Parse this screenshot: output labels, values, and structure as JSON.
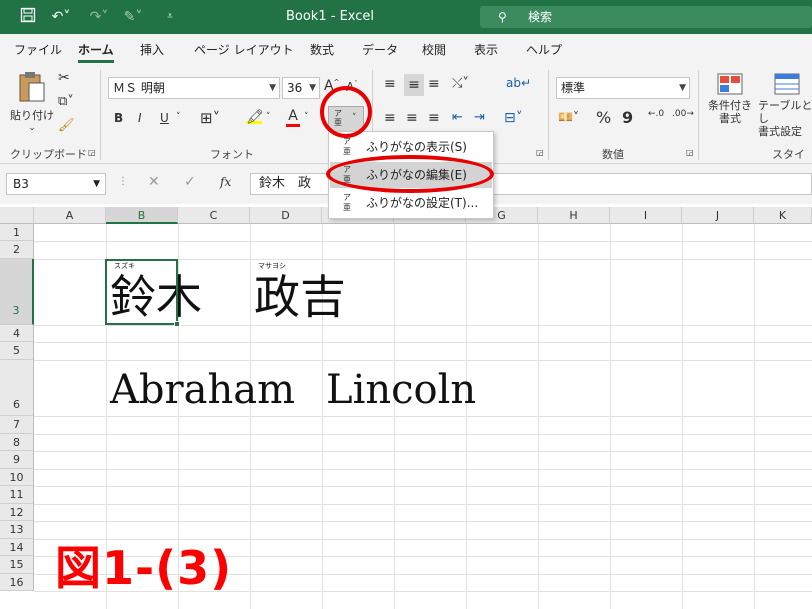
{
  "titlebar": {
    "title": "Book1  -  Excel",
    "search_label": "検索",
    "bg_color": "#217346"
  },
  "menu": {
    "items": [
      "ファイル",
      "ホーム",
      "挿入",
      "ページ レイアウト",
      "数式",
      "データ",
      "校閲",
      "表示",
      "ヘルプ"
    ],
    "active": "ホーム"
  },
  "ribbon": {
    "clipboard": {
      "paste_label": "貼り付け",
      "group_label": "クリップボード"
    },
    "font": {
      "font_name": "ＭＳ 明朝",
      "font_size": "36",
      "group_label": "フォント",
      "bold": "B",
      "italic": "I",
      "underline": "U"
    },
    "number": {
      "format": "標準",
      "group_label": "数値",
      "percent": "%",
      "comma": "9",
      "inc": ".0",
      "dec": ".00"
    },
    "styles": {
      "cond_format": "条件付き\n書式",
      "table_format": "テーブルとし\n書式設定",
      "group_label": "スタイル"
    }
  },
  "formula_bar": {
    "name_box": "B3",
    "fx": "fx",
    "content": "鈴木　政"
  },
  "sheet": {
    "columns": [
      "A",
      "B",
      "C",
      "D",
      "E",
      "F",
      "G",
      "H",
      "I",
      "J",
      "K"
    ],
    "selected_column": "B",
    "rows": [
      "1",
      "2",
      "3",
      "4",
      "5",
      "6",
      "7",
      "8",
      "9",
      "10",
      "11",
      "12",
      "13",
      "14",
      "15",
      "16"
    ],
    "selected_row": "3",
    "cells": {
      "b3": "鈴木",
      "b3_furigana": "スズキ",
      "d3": "政吉",
      "d3_furigana": "マサヨシ",
      "b6": "Abraham",
      "e6": "Lincoln"
    }
  },
  "phonetic_menu": {
    "items": [
      {
        "label": "ふりがなの表示(S)",
        "icon": "phonetic-show-icon"
      },
      {
        "label": "ふりがなの編集(E)",
        "icon": "phonetic-edit-icon"
      },
      {
        "label": "ふりがなの設定(T)...",
        "icon": "phonetic-settings-icon"
      }
    ],
    "highlighted": 1
  },
  "annotation": {
    "figure_label": "図1-(3)",
    "color": "#e60000"
  }
}
